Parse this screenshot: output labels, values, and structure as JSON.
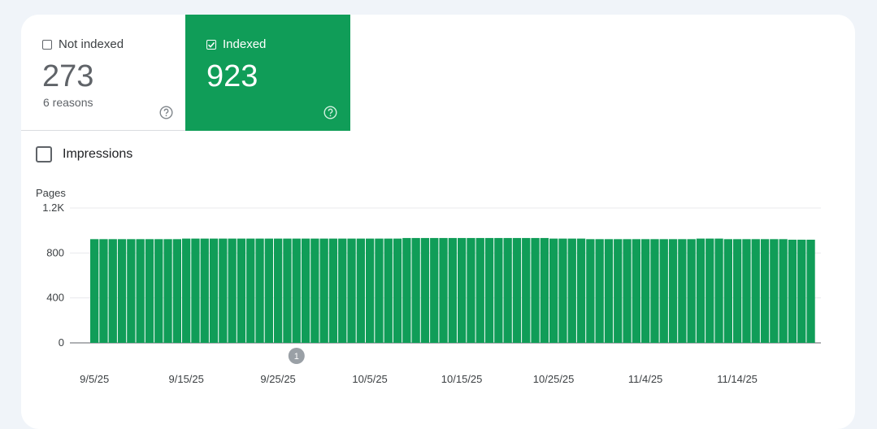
{
  "tiles": {
    "not_indexed": {
      "label": "Not indexed",
      "value": "273",
      "sub": "6 reasons",
      "checked": false
    },
    "indexed": {
      "label": "Indexed",
      "value": "923",
      "checked": true
    }
  },
  "impressions": {
    "label": "Impressions",
    "checked": false
  },
  "colors": {
    "bar": "#109d58",
    "indexed_tile": "#109d58",
    "background": "#f0f4f9",
    "annotation": "#9aa0a6"
  },
  "chart_data": {
    "type": "bar",
    "ylabel": "Pages",
    "ylim": [
      0,
      1200
    ],
    "yticks": [
      0,
      400,
      800,
      1200
    ],
    "ytick_labels": [
      "0",
      "400",
      "800",
      "1.2K"
    ],
    "xtick_labels": [
      "9/5/25",
      "9/15/25",
      "9/25/25",
      "10/5/25",
      "10/15/25",
      "10/25/25",
      "11/4/25",
      "11/14/25"
    ],
    "xtick_indices": [
      0,
      10,
      20,
      30,
      40,
      50,
      60,
      70
    ],
    "dates_first": "9/5/25",
    "values": [
      923,
      923,
      923,
      923,
      923,
      923,
      923,
      923,
      923,
      923,
      928,
      928,
      928,
      928,
      928,
      928,
      928,
      928,
      928,
      928,
      928,
      928,
      928,
      928,
      928,
      928,
      928,
      928,
      928,
      928,
      928,
      928,
      928,
      928,
      933,
      933,
      933,
      933,
      933,
      933,
      933,
      933,
      933,
      933,
      933,
      933,
      933,
      933,
      933,
      933,
      928,
      928,
      928,
      928,
      923,
      923,
      923,
      923,
      923,
      923,
      923,
      923,
      923,
      923,
      923,
      923,
      928,
      928,
      928,
      923,
      923,
      923,
      923,
      923,
      923,
      923,
      918,
      918,
      918
    ],
    "annotation": {
      "label": "1",
      "index": 22
    },
    "grid": true
  }
}
